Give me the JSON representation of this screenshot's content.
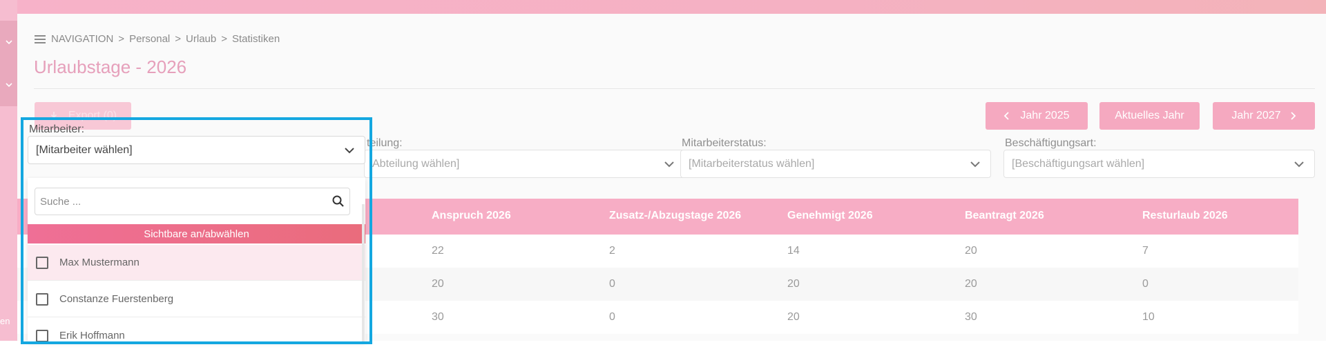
{
  "breadcrumb": {
    "nav": "NAVIGATION",
    "items": [
      "Personal",
      "Urlaub",
      "Statistiken"
    ],
    "separator": ">"
  },
  "page_title": "Urlaubstage - 2026",
  "toolbar": {
    "export_label": "Export (0)",
    "prev_label": "Jahr 2025",
    "current_label": "Aktuelles Jahr",
    "next_label": "Jahr 2027"
  },
  "filters": {
    "mitarbeiter": {
      "label": "Mitarbeiter:",
      "value": "[Mitarbeiter wählen]"
    },
    "abteilung": {
      "label": "teilung:",
      "value": "Abteilung wählen]"
    },
    "status": {
      "label": "Mitarbeiterstatus:",
      "value": "[Mitarbeiterstatus wählen]"
    },
    "art": {
      "label": "Beschäftigungsart:",
      "value": "[Beschäftigungsart wählen]"
    }
  },
  "dropdown": {
    "search_placeholder": "Suche ...",
    "toggle_label": "Sichtbare an/abwählen",
    "items": [
      "Max Mustermann",
      "Constanze Fuerstenberg",
      "Erik Hoffmann"
    ]
  },
  "table": {
    "headers": [
      "Anspruch 2026",
      "Zusatz-/Abzugstage 2026",
      "Genehmigt 2026",
      "Beantragt 2026",
      "Resturlaub 2026"
    ],
    "rows": [
      [
        "22",
        "2",
        "14",
        "20",
        "7"
      ],
      [
        "20",
        "0",
        "20",
        "20",
        "0"
      ],
      [
        "30",
        "0",
        "20",
        "30",
        "10"
      ]
    ]
  },
  "sidebar": {
    "partial_text": "en"
  },
  "colors": {
    "accent": "#f5a9c0",
    "highlight_frame": "#14a7e0",
    "title": "#e6a0bb"
  }
}
